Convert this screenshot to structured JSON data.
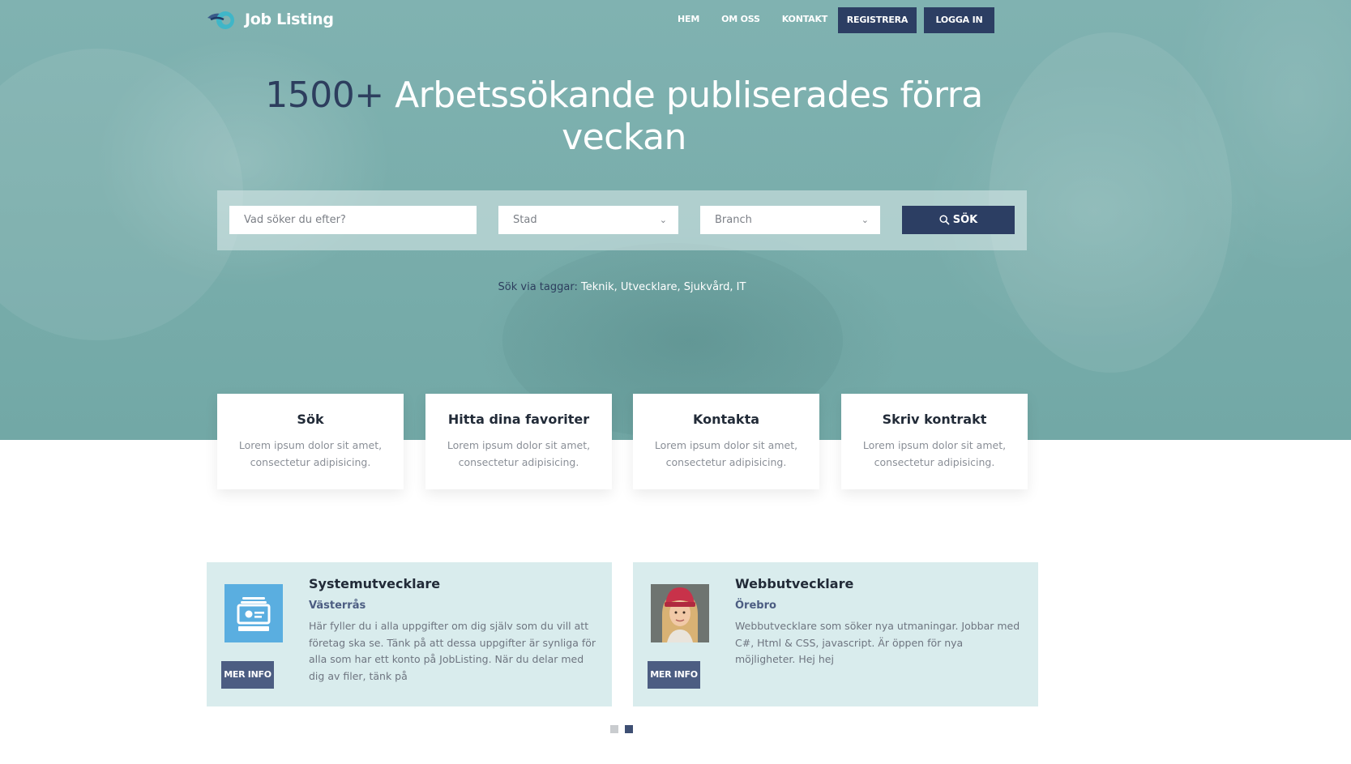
{
  "nav": {
    "logo_text": "Job Listing",
    "links": [
      "HEM",
      "OM OSS",
      "KONTAKT"
    ],
    "register_label": "REGISTRERA",
    "login_label": "LOGGA IN"
  },
  "hero": {
    "headline_number": "1500+",
    "headline_text": " Arbetssökande publiserades förra veckan"
  },
  "search": {
    "query_placeholder": "Vad söker du efter?",
    "city_value": "Stad",
    "branch_value": "Branch",
    "button_label": "SÖK",
    "tags_prefix": "Sök via taggar: ",
    "tags": "Teknik, Utvecklare, Sjukvård, IT"
  },
  "features": [
    {
      "title": "Sök",
      "text": "Lorem ipsum dolor sit amet, consectetur adipisicing."
    },
    {
      "title": "Hitta dina favoriter",
      "text": "Lorem ipsum dolor sit amet, consectetur adipisicing."
    },
    {
      "title": "Kontakta",
      "text": "Lorem ipsum dolor sit amet, consectetur adipisicing."
    },
    {
      "title": "Skriv kontrakt",
      "text": "Lorem ipsum dolor sit amet, consectetur adipisicing."
    }
  ],
  "jobs": [
    {
      "title": "Systemutvecklare",
      "city": "Västerrås",
      "description": "Här fyller du i alla uppgifter om dig själv som du vill att företag ska se. Tänk på att dessa uppgifter är synliga för alla som har ett konto på JobListing. När du delar med dig av filer, tänk på",
      "button_label": "MER INFO",
      "thumb": "id-card-icon"
    },
    {
      "title": "Webbutvecklare",
      "city": "Örebro",
      "description": "Webbutvecklare som söker nya utmaningar. Jobbar med C#, Html & CSS, javascript. Är öppen för nya möjligheter. Hej hej",
      "button_label": "MER INFO",
      "thumb": "profile-photo"
    }
  ],
  "carousel": {
    "pages": 2,
    "active": 2
  },
  "colors": {
    "brand_dark": "#2c3e63",
    "hero_teal": "#7aaeac",
    "card_bg": "#d9eced",
    "accent_blue": "#5aaee0"
  }
}
